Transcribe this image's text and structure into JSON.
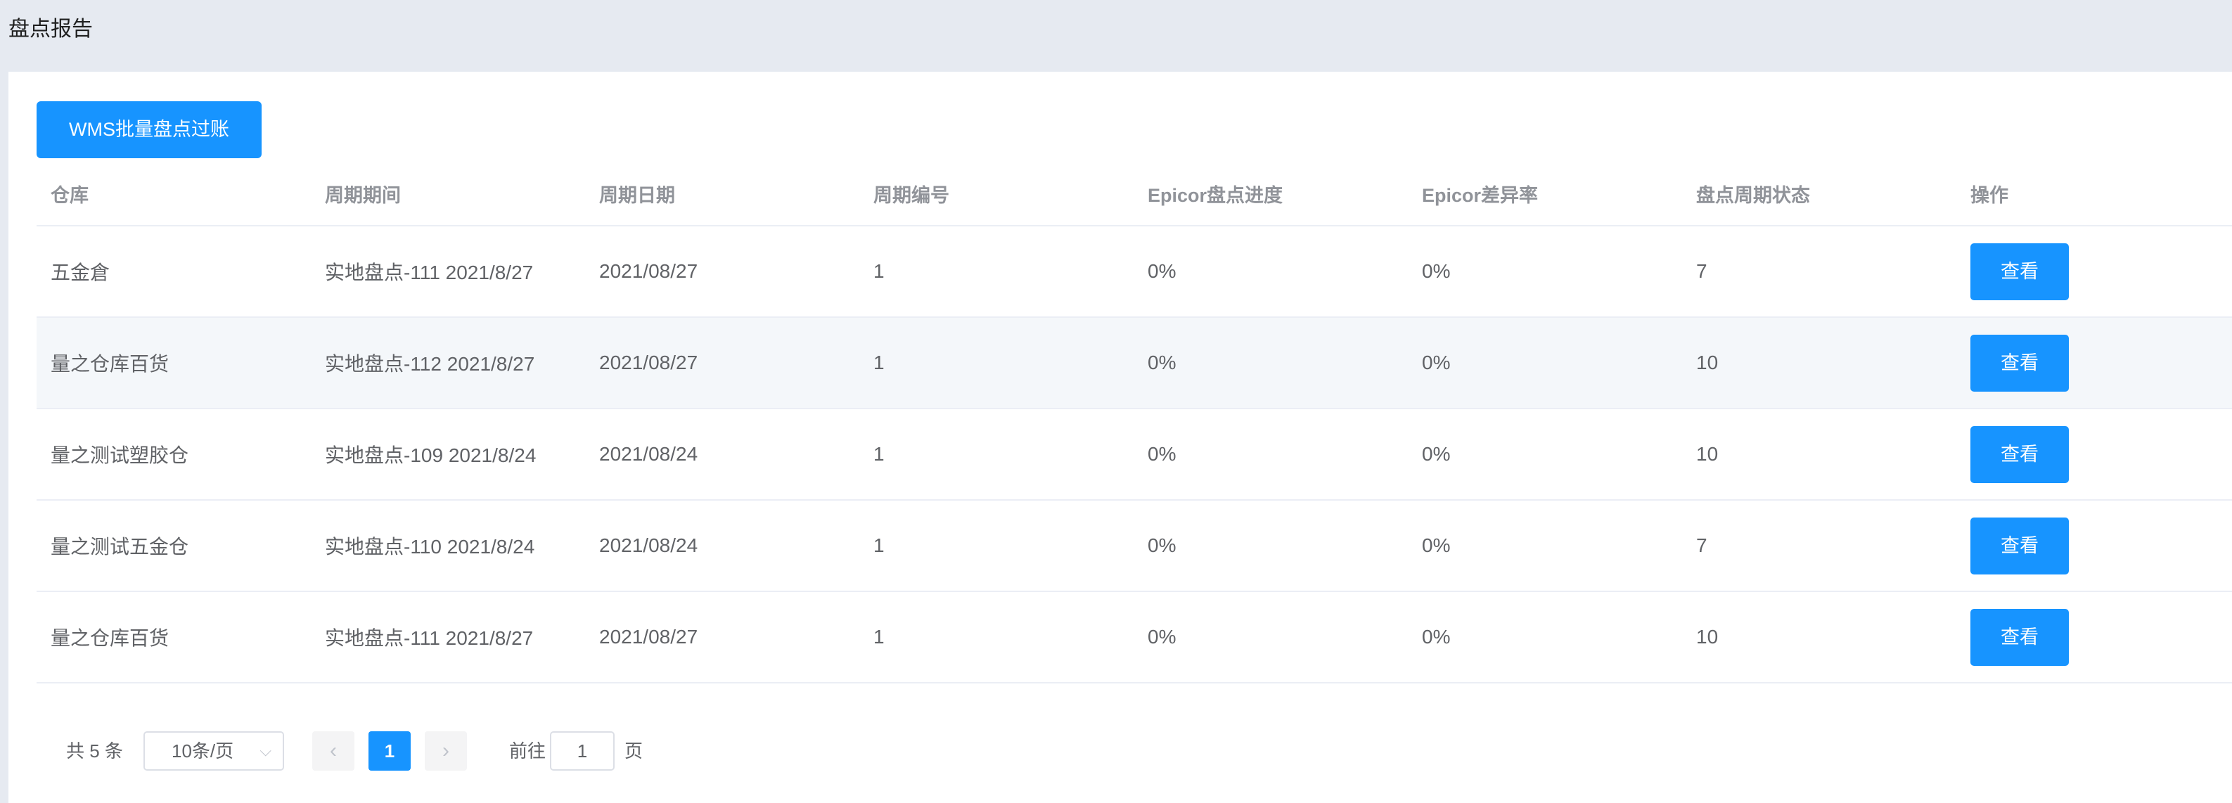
{
  "header": {
    "title": "盘点报告"
  },
  "toolbar": {
    "batch_label": "WMS批量盘点过账"
  },
  "table": {
    "columns": [
      "仓库",
      "周期期间",
      "周期日期",
      "周期编号",
      "Epicor盘点进度",
      "Epicor差异率",
      "盘点周期状态",
      "操作"
    ],
    "rows": [
      [
        "五金倉",
        "实地盘点-111 2021/8/27",
        "2021/08/27",
        "1",
        "0%",
        "0%",
        "7",
        "查看"
      ],
      [
        "量之仓库百货",
        "实地盘点-112 2021/8/27",
        "2021/08/27",
        "1",
        "0%",
        "0%",
        "10",
        "查看"
      ],
      [
        "量之测试塑胶仓",
        "实地盘点-109 2021/8/24",
        "2021/08/24",
        "1",
        "0%",
        "0%",
        "10",
        "查看"
      ],
      [
        "量之测试五金仓",
        "实地盘点-110 2021/8/24",
        "2021/08/24",
        "1",
        "0%",
        "0%",
        "7",
        "查看"
      ],
      [
        "量之仓库百货",
        "实地盘点-111 2021/8/27",
        "2021/08/27",
        "1",
        "0%",
        "0%",
        "10",
        "查看"
      ]
    ]
  },
  "pagination": {
    "total_text": "共 5 条",
    "page_size": "10条/页",
    "prev_icon": "‹",
    "next_icon": "›",
    "chevron_icon": "⌵",
    "current_page": "1",
    "goto_label": "前往",
    "goto_value": "1",
    "goto_suffix": "页"
  },
  "colors": {
    "accent": "#1794ff",
    "background": "#e6eaf1",
    "stripe": "#f4f7fa"
  }
}
